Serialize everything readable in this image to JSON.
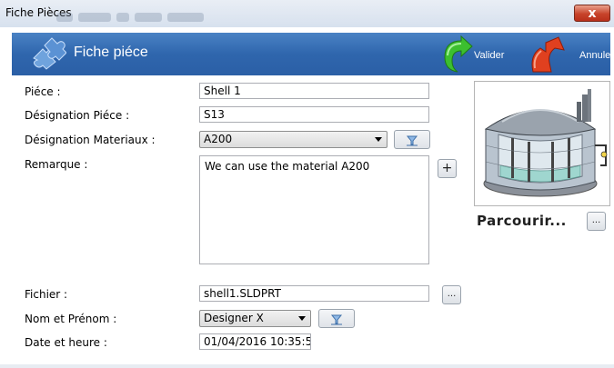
{
  "window": {
    "title": "Fiche Pièces",
    "close_label": "x"
  },
  "header": {
    "title": "Fiche piéce",
    "valider_label": "Valider",
    "annuler_label": "Annuler"
  },
  "form": {
    "piece_label": "Piéce :",
    "piece_value": "Shell 1",
    "designation_piece_label": "Désignation Piéce :",
    "designation_piece_value": "S13",
    "designation_materiaux_label": "Désignation Materiaux :",
    "designation_materiaux_value": "A200",
    "remarque_label": "Remarque :",
    "remarque_value": "We can use the material A200",
    "add_label": "+",
    "fichier_label": "Fichier :",
    "fichier_value": "shell1.SLDPRT",
    "browse_label": "...",
    "nom_label": "Nom et Prénom :",
    "nom_value": "Designer X",
    "date_label": "Date et heure :",
    "date_value": "01/04/2016 10:35:5"
  },
  "image_panel": {
    "parcourir_label": "Parcourir...",
    "browse_label": "..."
  },
  "icons": {
    "header_logo": "puzzle-icon",
    "valider": "green-arrow-icon",
    "annuler": "red-arrow-icon",
    "filter": "funnel-icon",
    "image": "storage-tank-image"
  }
}
